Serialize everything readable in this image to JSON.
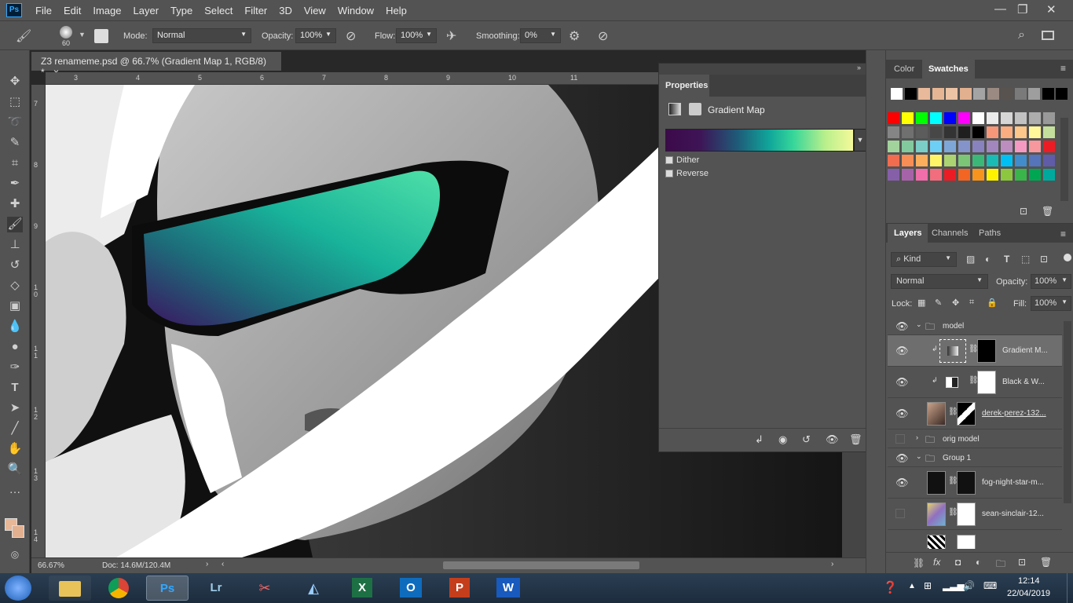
{
  "app": {
    "logo": "Ps"
  },
  "menu": [
    "File",
    "Edit",
    "Image",
    "Layer",
    "Type",
    "Select",
    "Filter",
    "3D",
    "View",
    "Window",
    "Help"
  ],
  "window_controls": {
    "minimize": "—",
    "restore": "❐",
    "close": "✕"
  },
  "options": {
    "brush_size": "60",
    "mode_label": "Mode:",
    "mode_value": "Normal",
    "opacity_label": "Opacity:",
    "opacity_value": "100%",
    "flow_label": "Flow:",
    "flow_value": "100%",
    "smoothing_label": "Smoothing:",
    "smoothing_value": "0%"
  },
  "document": {
    "tab_title": "Z3 renameme.psd @ 66.7% (Gradient Map 1, RGB/8) *",
    "close": "×",
    "ruler_h": [
      "3",
      "4",
      "5",
      "6",
      "7",
      "8",
      "9",
      "10",
      "11"
    ],
    "ruler_v": [
      "7",
      "8",
      "9",
      "1 0",
      "1 1",
      "1 2",
      "1 3",
      "1 4"
    ],
    "zoom": "66.67%",
    "doc_size": "Doc: 14.6M/120.4M"
  },
  "properties": {
    "tab": "Properties",
    "adjustment_name": "Gradient Map",
    "dither_label": "Dither",
    "reverse_label": "Reverse",
    "gradient_colors": [
      "#3c0a4a",
      "#1f5a78",
      "#10a59a",
      "#36d69a",
      "#b9ef8c",
      "#f4f99a"
    ]
  },
  "swatches_panel": {
    "tabs": [
      "Color",
      "Swatches"
    ],
    "active_tab": "Swatches",
    "recent": [
      "#ffffff",
      "#000000",
      "#e8b99a",
      "#e6b694",
      "#ecc3a4",
      "#e2b08f",
      "#a4a4a4",
      "#9a8a82",
      "#595350",
      "#7a7a7a",
      "#9e9e9e",
      "#000000",
      "#000000"
    ],
    "grid": [
      [
        "#ff0000",
        "#ffff00",
        "#00ff00",
        "#00ffff",
        "#0000ff",
        "#ff00ff",
        "#ffffff",
        "#ebebeb",
        "#d6d6d6",
        "#c2c2c2",
        "#adadad",
        "#999999"
      ],
      [
        "#858585",
        "#707070",
        "#5c5c5c",
        "#474747",
        "#333333",
        "#1f1f1f",
        "#000000",
        "#f7977a",
        "#f9ad81",
        "#fdc68a",
        "#fff79a",
        "#c4df9b"
      ],
      [
        "#a2d39c",
        "#82ca9d",
        "#7bcdc8",
        "#6ecff6",
        "#7ea7d8",
        "#8493ca",
        "#8882be",
        "#a187be",
        "#bc8dbf",
        "#f49ac2",
        "#f6989d",
        "#ed1c24"
      ],
      [
        "#f26c4f",
        "#f68e55",
        "#fbaf5c",
        "#fff467",
        "#acd372",
        "#7cc576",
        "#3bb878",
        "#1abbb4",
        "#00bff3",
        "#438ccb",
        "#5574b9",
        "#605ca8"
      ],
      [
        "#855fa8",
        "#a763a8",
        "#f06ea9",
        "#f26d7d",
        "#ed1c24",
        "#f26522",
        "#f7941d",
        "#fff200",
        "#8dc73f",
        "#39b54a",
        "#00a651",
        "#00a99d"
      ]
    ]
  },
  "layers_panel": {
    "tabs": [
      "Layers",
      "Channels",
      "Paths"
    ],
    "active_tab": "Layers",
    "kind_label": "Kind",
    "blend_mode": "Normal",
    "opacity_label": "Opacity:",
    "opacity_value": "100%",
    "lock_label": "Lock:",
    "fill_label": "Fill:",
    "fill_value": "100%",
    "layers": [
      {
        "name": "model",
        "kind": "group",
        "visible": true,
        "expanded": true
      },
      {
        "name": "Gradient M...",
        "kind": "adjustment",
        "visible": true,
        "selected": true
      },
      {
        "name": "Black & W...",
        "kind": "adjustment",
        "visible": true
      },
      {
        "name": "derek-perez-132...",
        "kind": "image",
        "visible": true
      },
      {
        "name": "orig model",
        "kind": "group",
        "visible": false,
        "expanded": false
      },
      {
        "name": "Group 1",
        "kind": "group",
        "visible": true,
        "expanded": true
      },
      {
        "name": "fog-night-star-m...",
        "kind": "image",
        "visible": true
      },
      {
        "name": "sean-sinclair-12...",
        "kind": "image",
        "visible": false
      }
    ]
  },
  "taskbar": {
    "time": "12:14",
    "date": "22/04/2019",
    "apps": [
      "Ps",
      "Lr",
      "X",
      "O",
      "P",
      "W"
    ]
  }
}
